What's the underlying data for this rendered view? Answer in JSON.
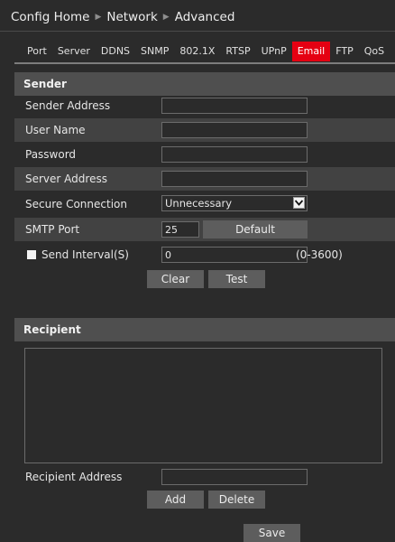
{
  "breadcrumb": {
    "home": "Config Home",
    "level1": "Network",
    "level2": "Advanced"
  },
  "tabs": [
    {
      "label": "Port"
    },
    {
      "label": "Server"
    },
    {
      "label": "DDNS"
    },
    {
      "label": "SNMP"
    },
    {
      "label": "802.1X"
    },
    {
      "label": "RTSP"
    },
    {
      "label": "UPnP"
    },
    {
      "label": "Email",
      "active": true
    },
    {
      "label": "FTP"
    },
    {
      "label": "QoS"
    }
  ],
  "sender": {
    "title": "Sender",
    "sender_address_label": "Sender Address",
    "sender_address_value": "",
    "user_name_label": "User Name",
    "user_name_value": "",
    "password_label": "Password",
    "password_value": "",
    "server_address_label": "Server Address",
    "server_address_value": "",
    "secure_connection_label": "Secure Connection",
    "secure_connection_value": "Unnecessary",
    "smtp_port_label": "SMTP Port",
    "smtp_port_value": "25",
    "default_button": "Default",
    "send_interval_label": "Send Interval(S)",
    "send_interval_value": "0",
    "send_interval_range": "(0-3600)",
    "clear_button": "Clear",
    "test_button": "Test"
  },
  "recipient": {
    "title": "Recipient",
    "recipient_address_label": "Recipient Address",
    "recipient_address_value": "",
    "add_button": "Add",
    "delete_button": "Delete"
  },
  "save_button": "Save",
  "colors": {
    "accent": "#e50012",
    "background": "#2b2b2b",
    "section_header": "#4f4f4f",
    "row_alt": "#424242",
    "button": "#5d5d5d"
  }
}
